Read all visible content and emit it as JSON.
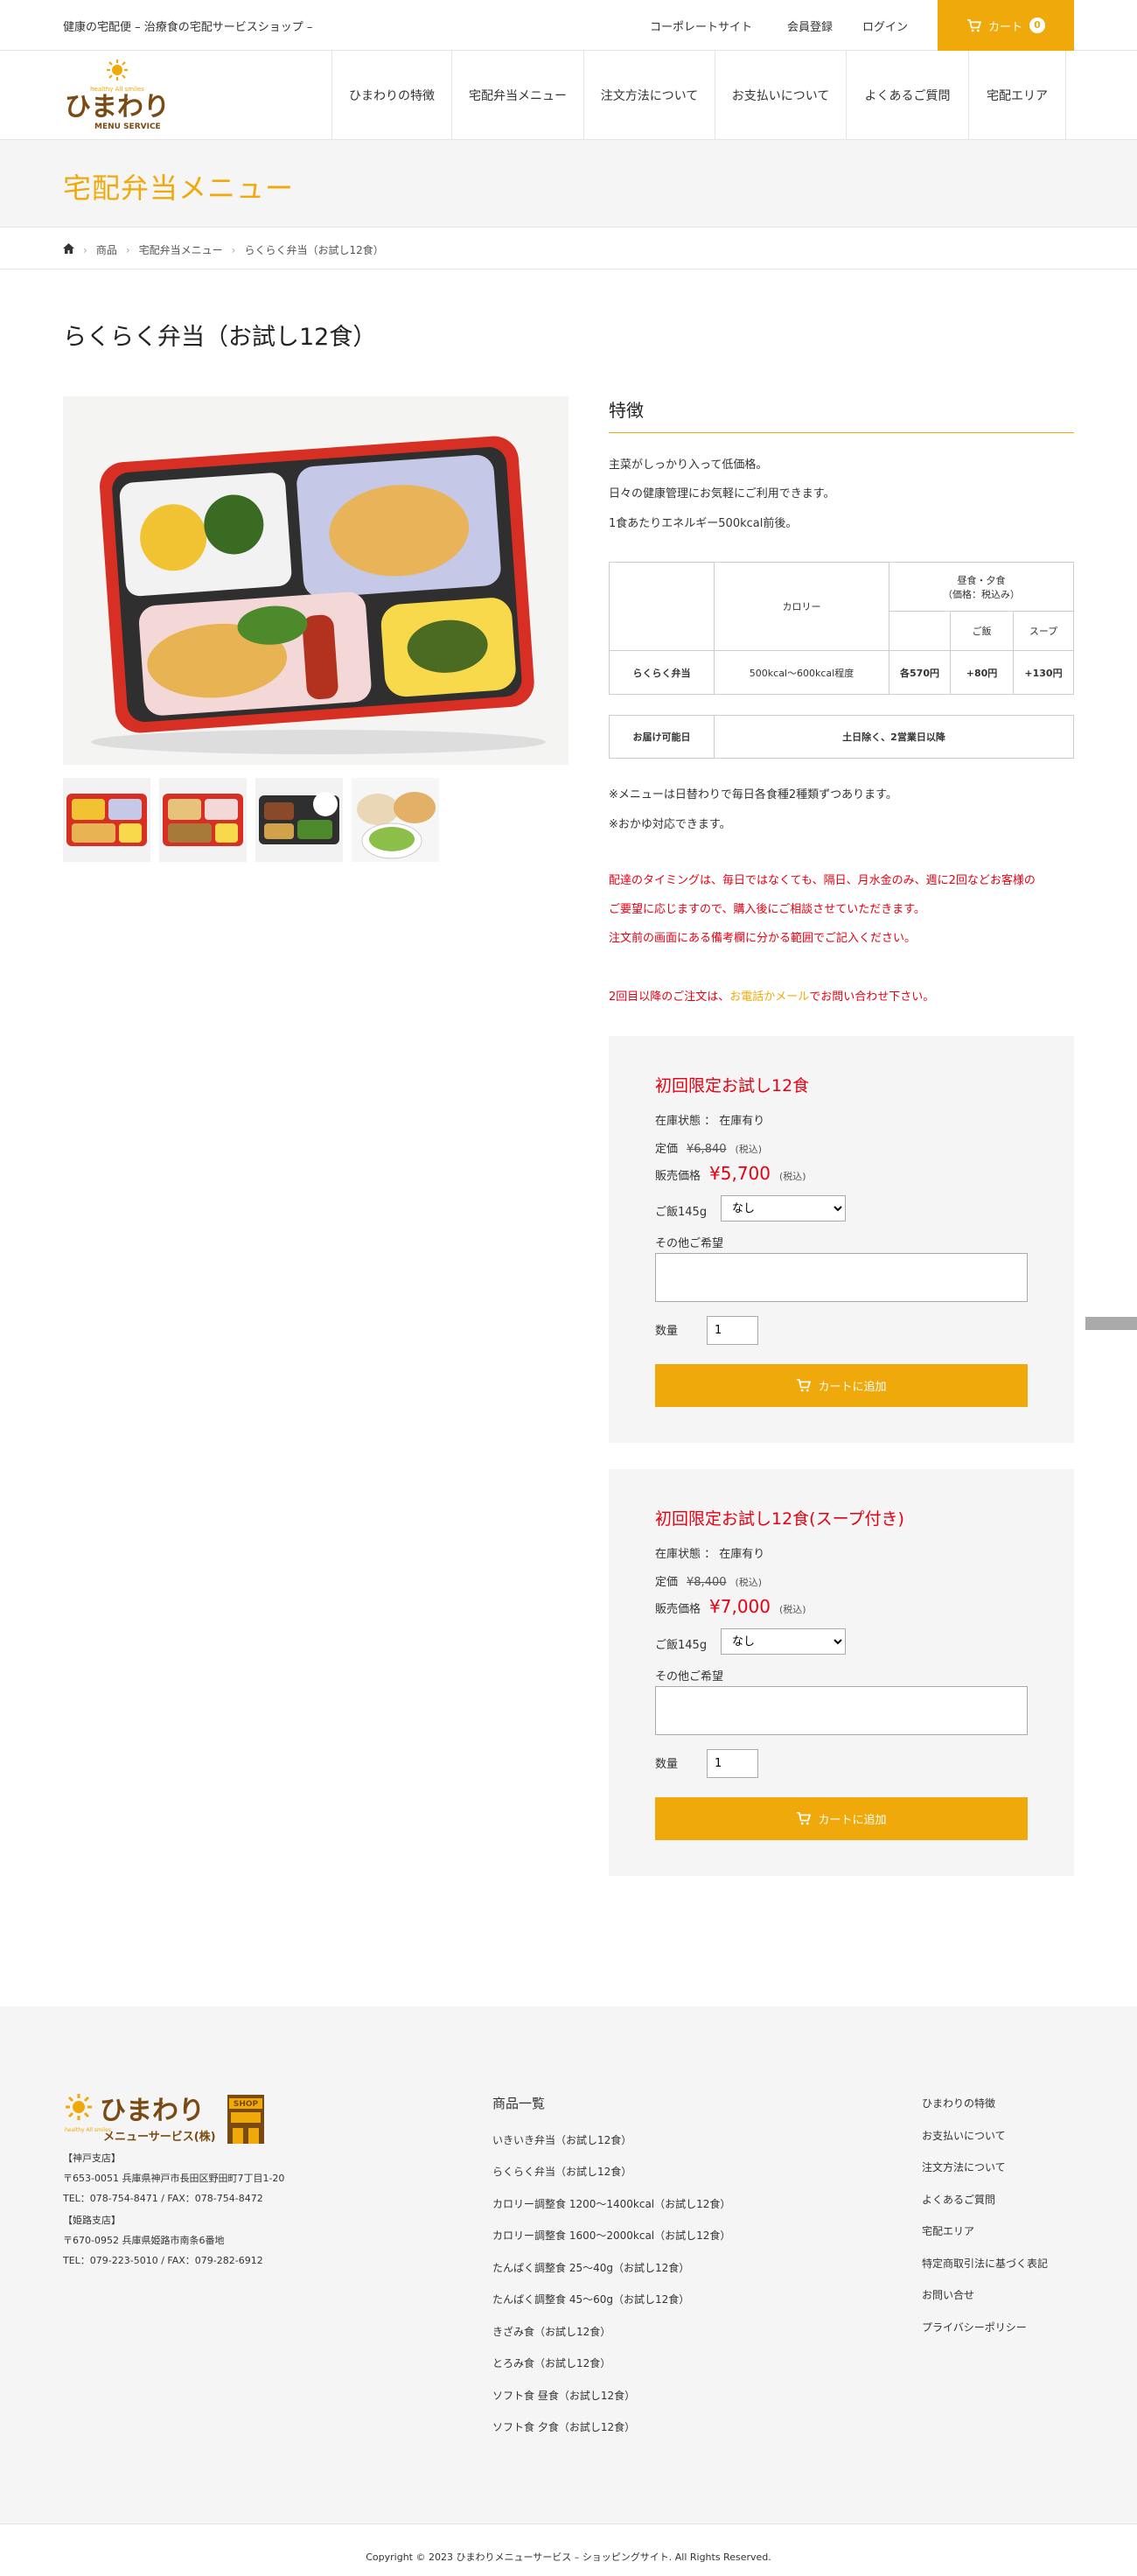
{
  "topbar": {
    "tagline": "健康の宅配便 – 治療食の宅配サービスショップ –",
    "links": [
      "コーポレートサイト",
      "会員登録",
      "ログイン"
    ],
    "cart_label": "カート",
    "cart_count": "0"
  },
  "header": {
    "logo_tagline": "healthy All smiles",
    "logo_name": "ひまわり",
    "logo_sub": "MENU SERVICE",
    "nav": [
      "ひまわりの特徴",
      "宅配弁当メニュー",
      "注文方法について",
      "お支払いについて",
      "よくあるご質問",
      "宅配エリア"
    ]
  },
  "page_heading": "宅配弁当メニュー",
  "breadcrumb": [
    "商品",
    "宅配弁当メニュー",
    "らくらく弁当（お試し12食）"
  ],
  "product_title": "らくらく弁当（お試し12食）",
  "features": {
    "heading": "特徴",
    "lines": [
      "主菜がしっかり入って低価格。",
      "日々の健康管理にお気軽にご利用できます。",
      "1食あたりエネルギー500kcal前後。"
    ]
  },
  "price_table": {
    "col_calorie": "カロリー",
    "col_meal": "昼食・夕食",
    "col_meal_note": "（価格：税込み）",
    "col_rice": "ご飯",
    "col_soup": "スープ",
    "row_name": "らくらく弁当",
    "row_calorie": "500kcal～600kcal程度",
    "row_price": "各570円",
    "row_rice": "+80円",
    "row_soup": "+130円"
  },
  "delivery": {
    "label": "お届け可能日",
    "value": "土日除く、2営業日以降"
  },
  "notes": [
    "※メニューは日替わりで毎日各食種2種類ずつあります。",
    "※おかゆ対応できます。"
  ],
  "red_notes": [
    "配達のタイミングは、毎日ではなくても、隔日、月水金のみ、週に2回などお客様の",
    "ご要望に応じますので、購入後にご相談させていただきます。",
    "注文前の画面にある備考欄に分かる範囲でご記入ください。"
  ],
  "contact_note": {
    "prefix": "2回目以降のご注文は、",
    "link": "お電話かメール",
    "suffix": "でお問い合わせ下さい。"
  },
  "purchase_boxes": [
    {
      "title": "初回限定お試し12食",
      "stock_label": "在庫状態 ： 在庫有り",
      "list_label": "定価",
      "list_price": "¥6,840",
      "list_tax": "(税込)",
      "sale_label": "販売価格",
      "sale_price": "¥5,700",
      "sale_tax": "(税込)",
      "rice_label": "ご飯145g",
      "rice_option": "なし",
      "other_label": "その他ご希望",
      "qty_label": "数量",
      "qty_value": "1",
      "add_label": "カートに追加"
    },
    {
      "title": "初回限定お試し12食(スープ付き)",
      "stock_label": "在庫状態 ： 在庫有り",
      "list_label": "定価",
      "list_price": "¥8,400",
      "list_tax": "(税込)",
      "sale_label": "販売価格",
      "sale_price": "¥7,000",
      "sale_tax": "(税込)",
      "rice_label": "ご飯145g",
      "rice_option": "なし",
      "other_label": "その他ご希望",
      "qty_label": "数量",
      "qty_value": "1",
      "add_label": "カートに追加"
    }
  ],
  "footer": {
    "logo_name": "ひまわり",
    "logo_company": "メニューサービス(株)",
    "logo_tag": "healthy All smiles",
    "shop_sign": "SHOP",
    "kobe_head": "【神戸支店】",
    "kobe_addr": "〒653-0051 兵庫県神戸市長田区野田町7丁目1-20",
    "kobe_tel": "TEL：078-754-8471 / FAX：078-754-8472",
    "himeji_head": "【姫路支店】",
    "himeji_addr": "〒670-0952 兵庫県姫路市南条6番地",
    "himeji_tel": "TEL：079-223-5010 / FAX：079-282-6912",
    "products_heading": "商品一覧",
    "products": [
      "いきいき弁当（お試し12食）",
      "らくらく弁当（お試し12食）",
      "カロリー調整食 1200～1400kcal（お試し12食）",
      "カロリー調整食 1600～2000kcal（お試し12食）",
      "たんぱく調整食 25～40g（お試し12食）",
      "たんぱく調整食 45～60g（お試し12食）",
      "きざみ食（お試し12食）",
      "とろみ食（お試し12食）",
      "ソフト食 昼食（お試し12食）",
      "ソフト食 夕食（お試し12食）"
    ],
    "links": [
      "ひまわりの特徴",
      "お支払いについて",
      "注文方法について",
      "よくあるご質問",
      "宅配エリア",
      "特定商取引法に基づく表記",
      "お問い合せ",
      "プライバシーポリシー"
    ],
    "copyright": "Copyright © 2023 ひまわりメニューサービス – ショッピングサイト. All Rights Reserved."
  },
  "colors": {
    "accent": "#efa90a",
    "red": "#e60012",
    "bg_gray": "#f5f5f5"
  }
}
